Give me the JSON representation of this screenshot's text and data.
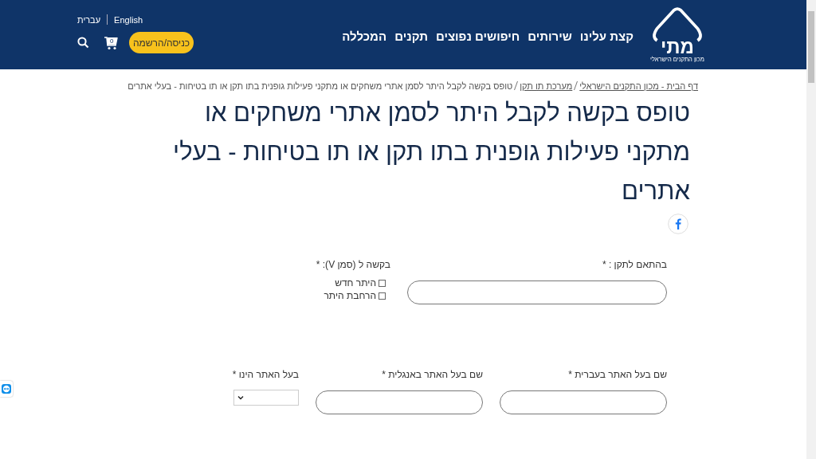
{
  "header": {
    "logo": {
      "mark": "מתי",
      "caption": "מכון התקנים הישראלי"
    },
    "nav": [
      {
        "label": "קצת עלינו"
      },
      {
        "label": "שירותים"
      },
      {
        "label": "חיפושים נפוצים"
      },
      {
        "label": "תקנים"
      },
      {
        "label": "המכללה"
      }
    ],
    "languages": [
      {
        "label": "English"
      },
      {
        "label": "עברית"
      }
    ],
    "login_button": "כניסה/הרשמה",
    "cart_count": "0"
  },
  "breadcrumb": [
    {
      "kind": "link",
      "label": "דף הבית - מכון התקנים הישראלי"
    },
    {
      "kind": "link",
      "label": "מערכת תו תקן"
    },
    {
      "kind": "current",
      "label": "טופס בקשה לקבל היתר לסמן אתרי משחקים או מתקני פעילות גופנית בתו תקן או תו בטיחות - בעלי אתרים"
    }
  ],
  "title": "טופס בקשה לקבל היתר לסמן אתרי משחקים או מתקני פעילות גופנית בתו תקן או תו בטיחות - בעלי אתרים",
  "form_rows": [
    {
      "fields": [
        {
          "kind": "text",
          "label": "בהתאם לתקן : *"
        },
        {
          "kind": "checkboxes",
          "label": "בקשה ל (סמן V): *",
          "options": [
            {
              "label": "היתר חדש",
              "checked": false
            },
            {
              "label": "הרחבת היתר",
              "checked": false
            }
          ]
        }
      ]
    },
    {
      "fields": [
        {
          "kind": "text",
          "label": "שם בעל האתר בעברית *"
        },
        {
          "kind": "text",
          "label": "שם בעל האתר באנגלית *"
        },
        {
          "kind": "select",
          "label": "בעל האתר הינו *"
        }
      ]
    }
  ]
}
